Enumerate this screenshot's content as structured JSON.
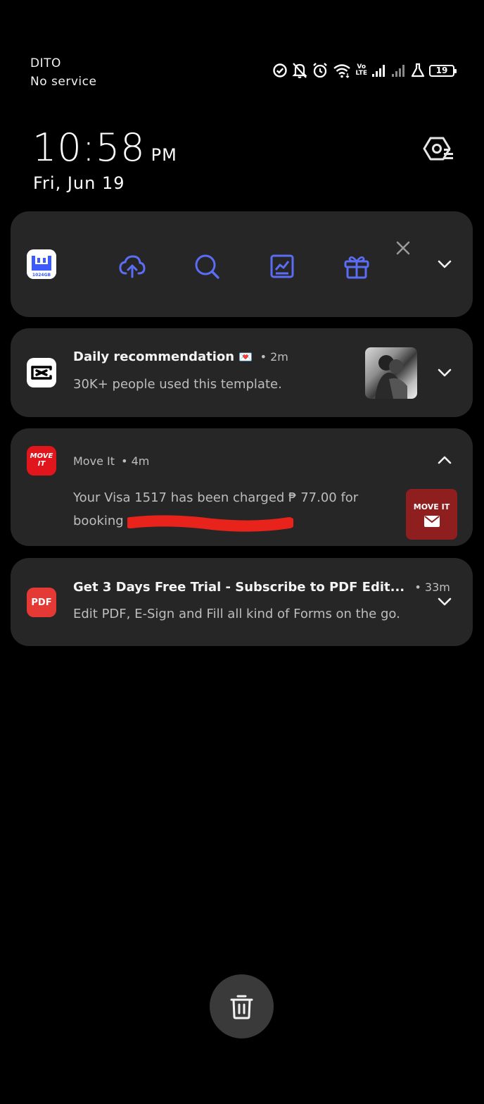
{
  "status_bar": {
    "carrier": "DITO",
    "service": "No service",
    "volte_top": "Vo",
    "volte_bottom": "LTE",
    "battery": "19"
  },
  "clock": {
    "time": "10:58",
    "ampm": "PM",
    "date": "Fri, Jun 19"
  },
  "widget": {
    "app_icon_label": "1024GB",
    "accent_color": "#5b6cf5",
    "actions": [
      "cloud-upload-icon",
      "search-icon",
      "chart-icon",
      "gift-icon"
    ]
  },
  "notifications": [
    {
      "app": "CapCut",
      "title": "Daily recommendation",
      "emoji": "💌",
      "time": "• 2m",
      "text": "30K+ people used this template."
    },
    {
      "app": "Move It",
      "time": "• 4m",
      "text_line1": "Your Visa 1517 has been charged ₱ 77.00 for",
      "text_line2": "booking",
      "icon_label_1": "MOVE",
      "icon_label_2": "IT",
      "thumb_label": "MOVE IT",
      "accent_color": "#e0161c"
    },
    {
      "app": "PDF",
      "icon_label": "PDF",
      "title": "Get 3 Days Free Trial - Subscribe to PDF Edit...",
      "time": "• 33m",
      "text": "Edit PDF, E-Sign and Fill all kind of Forms on the go.",
      "accent_color": "#e53935"
    }
  ]
}
